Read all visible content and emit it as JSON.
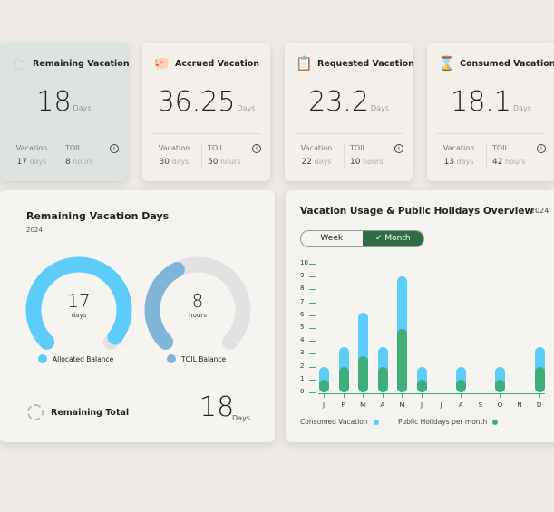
{
  "stats": [
    {
      "title": "Remaining Vacation",
      "icon": "timer-icon",
      "value": "18",
      "unit": "Days",
      "vacation_label": "Vacation",
      "vacation_value": "17",
      "vacation_unit": "days",
      "toil_label": "TOIL",
      "toil_value": "8",
      "toil_unit": "hours",
      "bg": "#dfe3df"
    },
    {
      "title": "Accrued Vacation",
      "icon": "piggy-bank-icon",
      "value": "36.25",
      "unit": "Days",
      "vacation_label": "Vacation",
      "vacation_value": "30",
      "vacation_unit": "days",
      "toil_label": "TOIL",
      "toil_value": "50",
      "toil_unit": "hours",
      "bg": "#f3f0ec"
    },
    {
      "title": "Requested Vacation",
      "icon": "clipboard-clock-icon",
      "value": "23.2",
      "unit": "Days",
      "vacation_label": "Vacation",
      "vacation_value": "22",
      "vacation_unit": "days",
      "toil_label": "TOIL",
      "toil_value": "10",
      "toil_unit": "hours",
      "bg": "#f3f0ec"
    },
    {
      "title": "Consumed Vacation",
      "icon": "hourglass-icon",
      "value": "18.1",
      "unit": "Days",
      "vacation_label": "Vacation",
      "vacation_value": "13",
      "vacation_unit": "days",
      "toil_label": "TOIL",
      "toil_value": "42",
      "toil_unit": "hours",
      "bg": "#f3f0ec"
    }
  ],
  "remaining": {
    "title": "Remaining Vacation Days",
    "year": "2024",
    "gauges": [
      {
        "value": "17",
        "unit": "days",
        "legend": "Allocated Balance",
        "color": "#5ccdfb",
        "fill": 0.97
      },
      {
        "value": "8",
        "unit": "hours",
        "legend": "TOIL Balance",
        "color": "#7fb5d9",
        "fill": 0.4
      }
    ],
    "total_label": "Remaining Total",
    "total_value": "18",
    "total_unit": "Days"
  },
  "usage": {
    "title": "Vacation Usage & Public Holidays Overview",
    "year": "2024",
    "toggle": {
      "week": "Week",
      "month": "Month",
      "active": "Month"
    }
  },
  "chart_data": {
    "type": "bar",
    "stacked": true,
    "categories": [
      "J",
      "F",
      "M",
      "A",
      "M",
      "J",
      "J",
      "A",
      "S",
      "O",
      "N",
      "D"
    ],
    "series": [
      {
        "name": "Public Holidays per month",
        "color": "#3fae7a",
        "values": [
          1,
          2,
          2.8,
          2,
          4.9,
          1,
          0,
          1,
          0,
          1,
          0,
          2
        ]
      },
      {
        "name": "Consumed Vacation",
        "color": "#5ccdfb",
        "values": [
          1,
          1.5,
          3.4,
          1.5,
          4.1,
          1,
          0,
          1,
          0,
          1,
          0,
          1.5
        ]
      }
    ],
    "yticks": [
      "0",
      "1",
      "2",
      "3",
      "4",
      "5",
      "6",
      "7",
      "8",
      "9",
      "10"
    ],
    "ylim": [
      0,
      10
    ],
    "legend": "bottom"
  }
}
